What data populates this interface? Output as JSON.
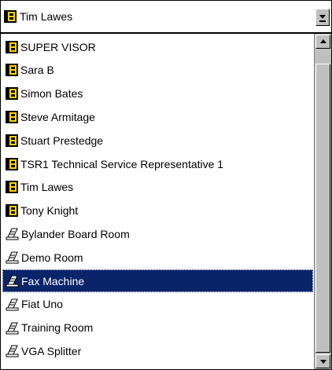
{
  "combo": {
    "selected_value": "Tim Lawes",
    "selected_icon": "person-icon"
  },
  "list": {
    "items": [
      {
        "label": "SUPER VISOR",
        "icon": "person-icon"
      },
      {
        "label": "Sara B",
        "icon": "person-icon"
      },
      {
        "label": "Simon Bates",
        "icon": "person-icon"
      },
      {
        "label": "Steve Armitage",
        "icon": "person-icon"
      },
      {
        "label": "Stuart Prestedge",
        "icon": "person-icon"
      },
      {
        "label": "TSR1 Technical Service Representative 1",
        "icon": "person-icon"
      },
      {
        "label": "Tim Lawes",
        "icon": "person-icon"
      },
      {
        "label": "Tony Knight",
        "icon": "person-icon"
      },
      {
        "label": "Bylander Board Room",
        "icon": "resource-icon"
      },
      {
        "label": "Demo Room",
        "icon": "resource-icon"
      },
      {
        "label": "Fax Machine",
        "icon": "resource-icon",
        "selected": true
      },
      {
        "label": "Fiat Uno",
        "icon": "resource-icon"
      },
      {
        "label": "Training Room",
        "icon": "resource-icon"
      },
      {
        "label": "VGA Splitter",
        "icon": "resource-icon"
      }
    ],
    "selection_color": "#0a246a"
  },
  "scrollbar": {
    "position": 0.95
  }
}
